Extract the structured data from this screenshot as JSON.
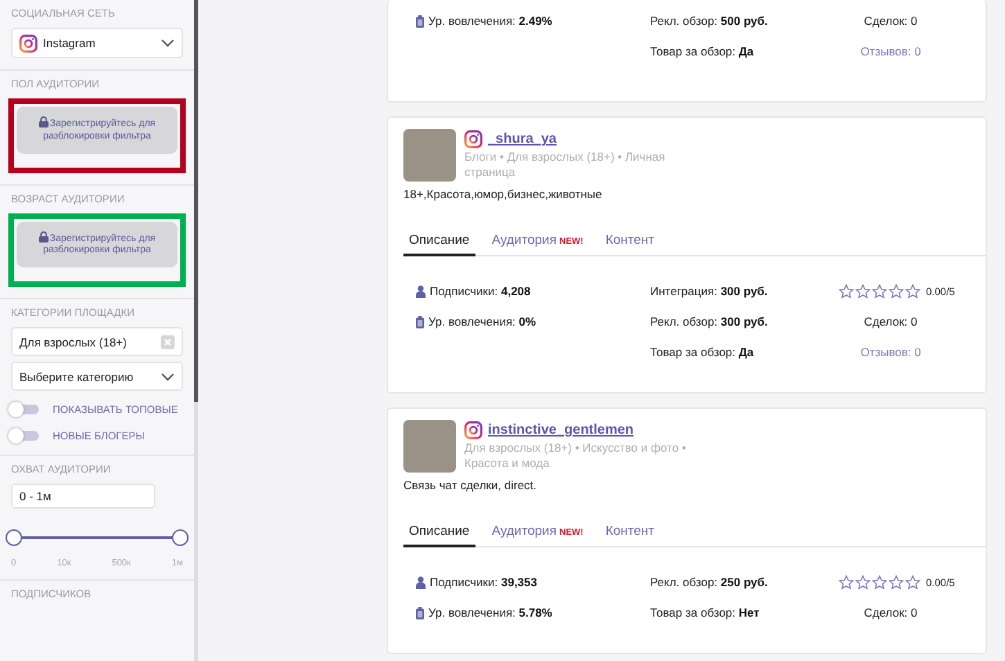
{
  "sidebar": {
    "sections": [
      {
        "kind": "select",
        "label": "СОЦИАЛЬНАЯ СЕТЬ",
        "value": "Instagram"
      },
      {
        "kind": "locked",
        "label": "ПОЛ АУДИТОРИИ",
        "message": "Зарегистрируйтесь для разблокировки фильтра",
        "color": "#b5001e"
      },
      {
        "kind": "locked",
        "label": "ВОЗРАСТ АУДИТОРИИ",
        "message": "Зарегистрируйтесь для разблокировки фильтра",
        "color": "#00b050"
      },
      {
        "kind": "categories",
        "label": "КАТЕГОРИИ ПЛОЩАДКИ",
        "tag": "Для взрослых (18+)",
        "placeholder": "Выберите категорию",
        "toggles": [
          {
            "label": "ПОКАЗЫВАТЬ ТОПОВЫЕ",
            "on": false
          },
          {
            "label": "НОВЫЕ БЛОГЕРЫ",
            "on": false
          }
        ]
      },
      {
        "kind": "range",
        "label": "ОХВАТ АУДИТОРИИ",
        "value": "0 - 1м",
        "thumbs": [
          {
            "level": 0
          },
          {
            "level": 1
          }
        ],
        "ticks": [
          "0",
          "10к",
          "500к",
          "1м"
        ]
      },
      {
        "kind": "heading",
        "label": "ПОДПИСЧИКОВ"
      }
    ]
  },
  "cards": [
    {
      "stats": {
        "left": [
          {
            "kind": "engagement",
            "label": "Ур. вовлечения:",
            "value": "2.49%"
          }
        ],
        "middle": [
          {
            "label": "Рекл. обзор:",
            "value": "500 руб."
          },
          {
            "label": "Товар за обзор:",
            "value": "Да"
          }
        ],
        "deals": "Сделок: 0",
        "reviews": "Отзывов: 0"
      }
    },
    {
      "handle": "_shura_ya",
      "categories": "Блоги • Для взрослых (18+) • Личная страница",
      "description": "18+,Красота,юмор,бизнес,животные",
      "tabs": [
        {
          "label": "Описание",
          "selected": true
        },
        {
          "label": "Аудитория",
          "badge": "NEW!",
          "selected": false
        },
        {
          "label": "Контент",
          "selected": false
        }
      ],
      "stats": {
        "left": [
          {
            "kind": "followers",
            "label": "Подписчики:",
            "value": "4,208"
          },
          {
            "kind": "engagement",
            "label": "Ур. вовлечения:",
            "value": "0%"
          }
        ],
        "middle": [
          {
            "label": "Интеграция:",
            "value": "300 руб."
          },
          {
            "label": "Рекл. обзор:",
            "value": "300 руб."
          },
          {
            "label": "Товар за обзор:",
            "value": "Да"
          }
        ],
        "stars": 0,
        "rating": "0.00/5",
        "deals": "Сделок: 0",
        "reviews": "Отзывов: 0"
      }
    },
    {
      "handle": "instinctive_gentlemen",
      "categories": "Для взрослых (18+) • Искусство и фото • Красота и мода",
      "description": "Связь чат сделки, direct.",
      "tabs": [
        {
          "label": "Описание",
          "selected": true
        },
        {
          "label": "Аудитория",
          "badge": "NEW!",
          "selected": false
        },
        {
          "label": "Контент",
          "selected": false
        }
      ],
      "stats": {
        "left": [
          {
            "kind": "followers",
            "label": "Подписчики:",
            "value": "39,353"
          },
          {
            "kind": "engagement",
            "label": "Ур. вовлечения:",
            "value": "5.78%"
          }
        ],
        "middle": [
          {
            "label": "Рекл. обзор:",
            "value": "250 руб."
          },
          {
            "label": "Товар за обзор:",
            "value": "Нет"
          }
        ],
        "stars": 0,
        "rating": "0.00/5",
        "deals": "Сделок: 0"
      }
    }
  ]
}
